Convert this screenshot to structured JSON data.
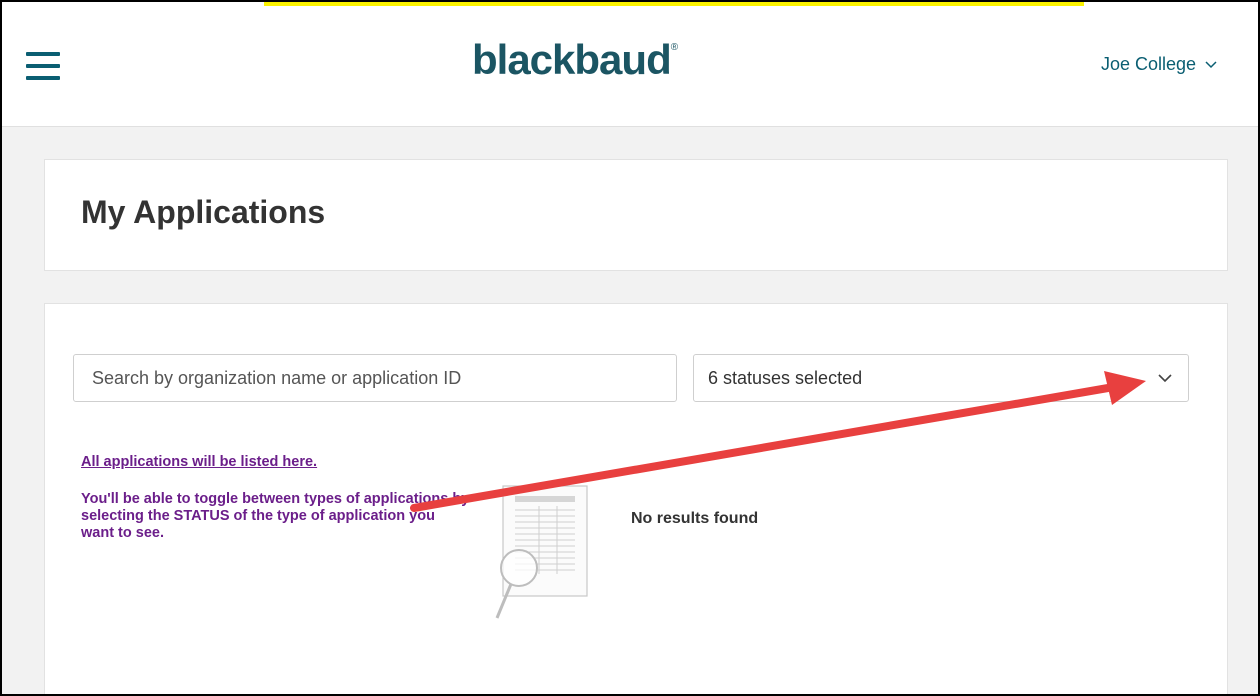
{
  "header": {
    "logo_text": "blackbaud",
    "logo_mark": "®",
    "user_name": "Joe College",
    "menu_icon": "hamburger-menu-icon",
    "brand_color": "#1b5563"
  },
  "page": {
    "title": "My Applications"
  },
  "filters": {
    "search_placeholder": "Search by organization name or application ID",
    "status_value": "6 statuses selected"
  },
  "annotation": {
    "link_text": "All applications will be listed here.",
    "body_text": "You'll be able to toggle between types of applications by selecting the STATUS of the type of application you want to see.",
    "color": "#6b1e8a",
    "arrow_color": "#e8403f"
  },
  "results": {
    "empty_message": "No results found",
    "empty_icon": "document-search-icon"
  }
}
